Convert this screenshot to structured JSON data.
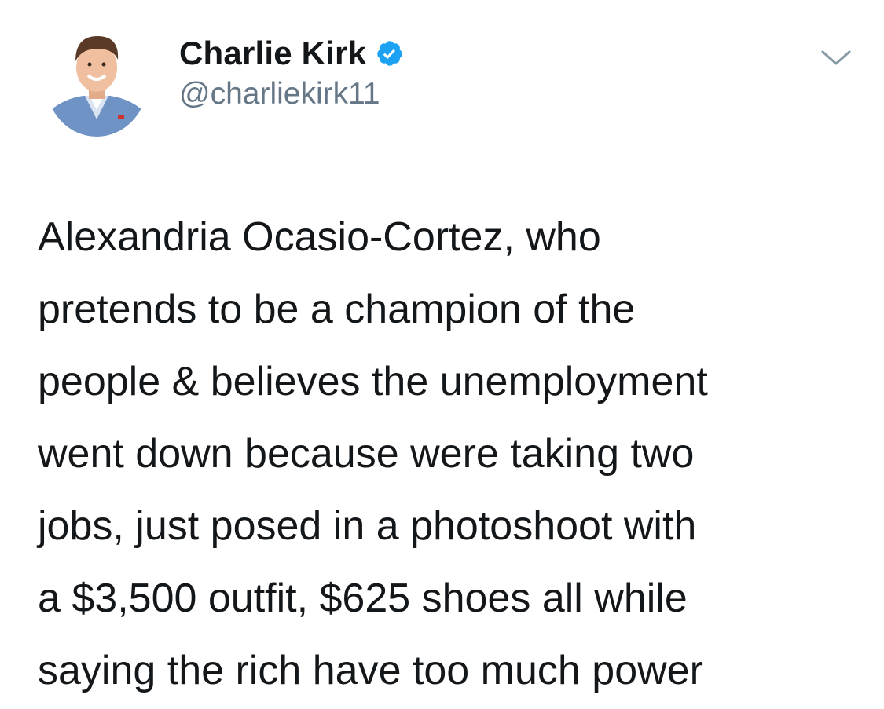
{
  "author": {
    "name": "Charlie Kirk",
    "handle": "@charliekirk11",
    "verified": true,
    "avatar_icon": "profile-photo"
  },
  "menu_icon": "chevron-down-icon",
  "tweet": {
    "lines": [
      "Alexandria Ocasio-Cortez, who",
      "pretends to be a champion of the",
      "people & believes the unemployment",
      "went down because were taking two",
      "jobs, just posed in a photoshoot with",
      "a $3,500 outfit, $625 shoes all while",
      "saying the rich have too much power"
    ]
  },
  "colors": {
    "text": "#14171a",
    "secondary": "#657786",
    "verified_blue": "#1da1f2",
    "background": "#ffffff"
  }
}
